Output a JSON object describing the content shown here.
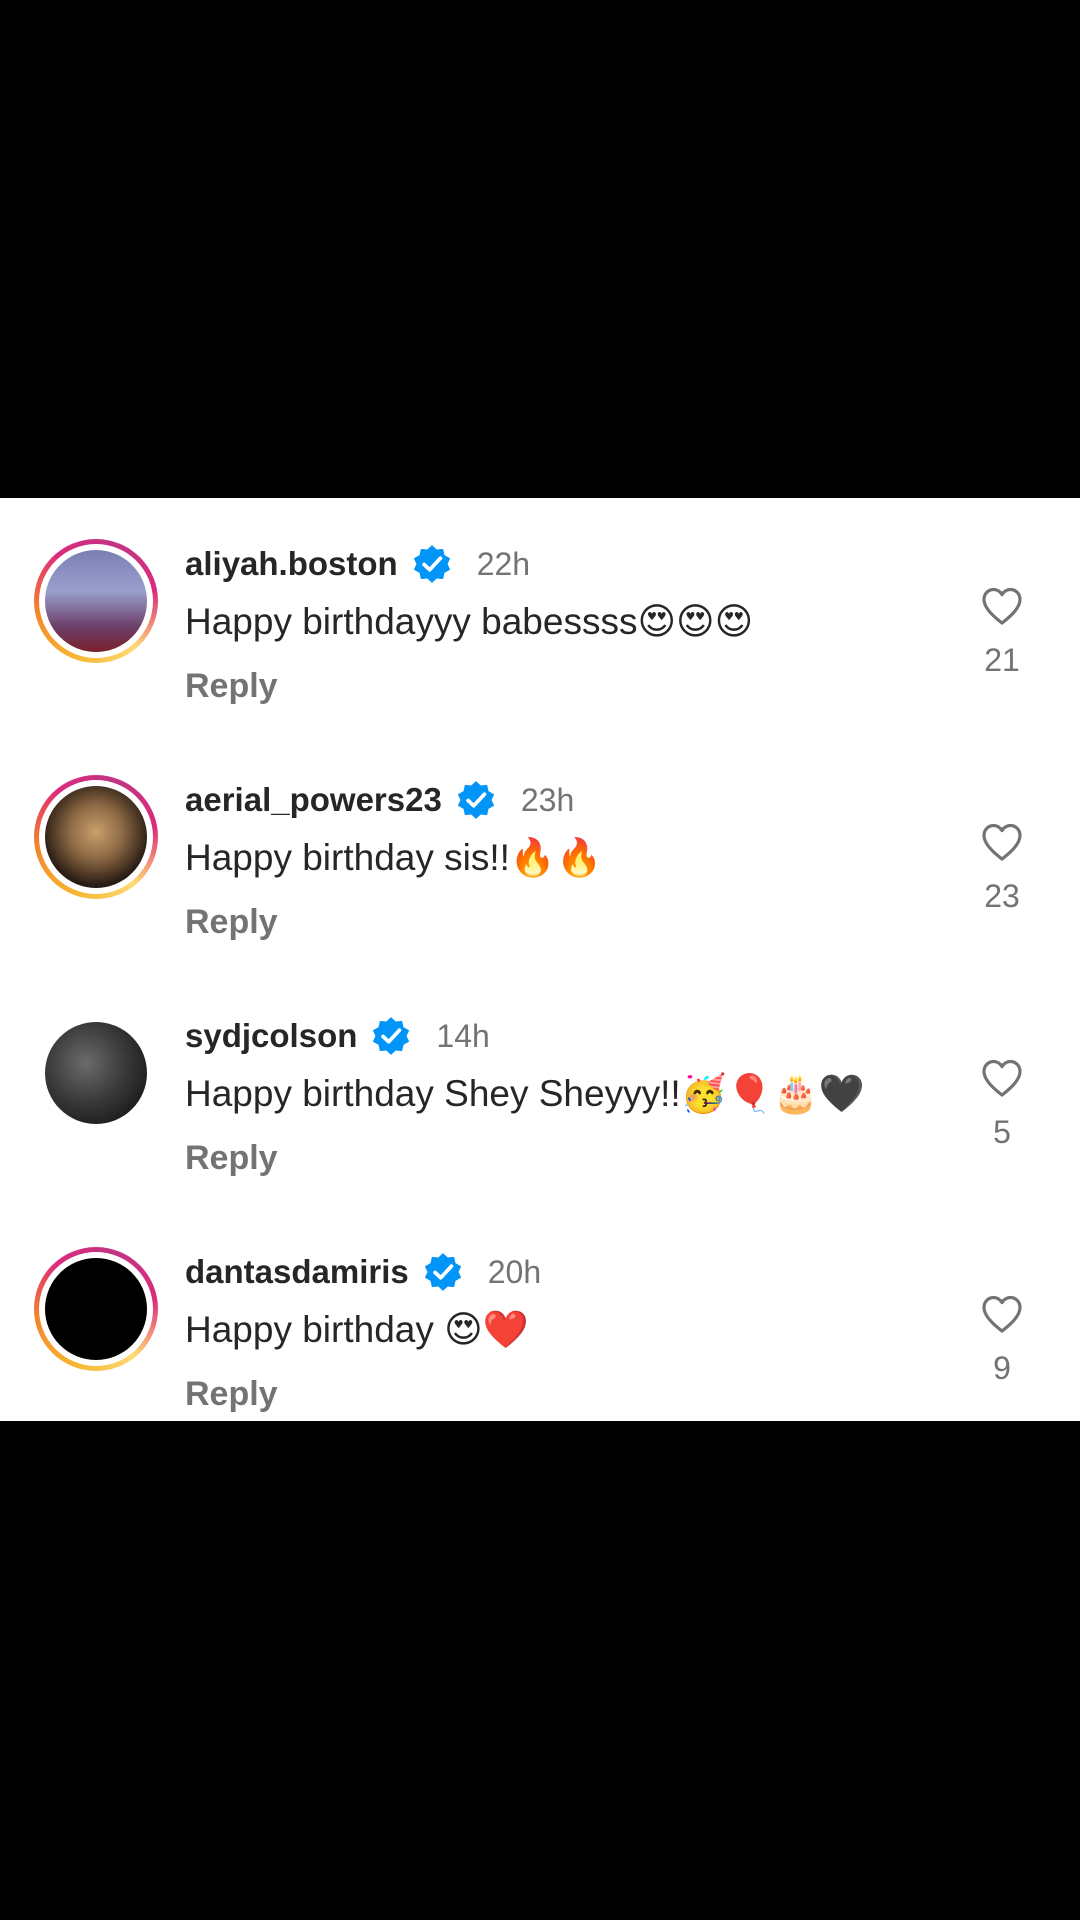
{
  "comments": [
    {
      "username": "aliyah.boston",
      "time": "22h",
      "text": "Happy birthdayyy babessss😍😍😍",
      "reply_label": "Reply",
      "likes": "21",
      "avatar_icon": "profile-photo"
    },
    {
      "username": "aerial_powers23",
      "time": "23h",
      "text": "Happy birthday sis!!🔥🔥",
      "reply_label": "Reply",
      "likes": "23",
      "avatar_icon": "profile-photo"
    },
    {
      "username": "sydjcolson",
      "time": "14h",
      "text": "Happy birthday Shey Sheyyy!!🥳🎈🎂🖤",
      "reply_label": "Reply",
      "likes": "5",
      "avatar_icon": "profile-photo"
    },
    {
      "username": "dantasdamiris",
      "time": "20h",
      "text": "Happy birthday 😍❤️",
      "reply_label": "Reply",
      "likes": "9",
      "avatar_icon": "profile-photo"
    }
  ],
  "icons": {
    "verified": "verified-badge-icon",
    "like": "heart-outline-icon"
  },
  "colors": {
    "verified_blue": "#0095f6",
    "text": "#262626",
    "muted": "#737373",
    "background": "#ffffff"
  }
}
